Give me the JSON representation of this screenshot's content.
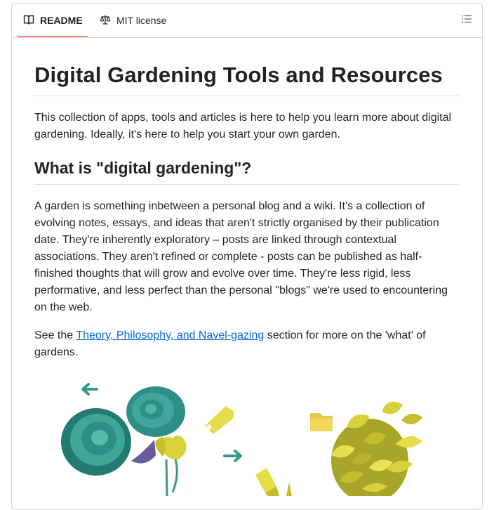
{
  "tabs": [
    {
      "label": "README",
      "icon": "book-icon",
      "active": true
    },
    {
      "label": "MIT license",
      "icon": "scale-icon",
      "active": false
    }
  ],
  "outline_button": {
    "icon": "list-unordered-icon"
  },
  "article": {
    "title": "Digital Gardening Tools and Resources",
    "intro": "This collection of apps, tools and articles is here to help you learn more about digital gardening. Ideally, it's here to help you start your own garden.",
    "section_heading": "What is \"digital gardening\"?",
    "garden_paragraph": "A garden is something inbetween a personal blog and a wiki. It's a collection of evolving notes, essays, and ideas that aren't strictly organised by their publication date. They're inherently exploratory – posts are linked through contextual associations. They aren't refined or complete - posts can be published as half-finished thoughts that will grow and evolve over time. They're less rigid, less performative, and less perfect than the personal \"blogs\" we're used to encountering on the web.",
    "see_prefix": "See the ",
    "see_link": "Theory, Philosophy, and Navel-gazing",
    "see_suffix": " section for more on the 'what' of gardens."
  },
  "colors": {
    "accent_underline": "#fd8c73",
    "link": "#0969da",
    "teal": "#2e8f86",
    "yellow": "#d9d13b"
  }
}
